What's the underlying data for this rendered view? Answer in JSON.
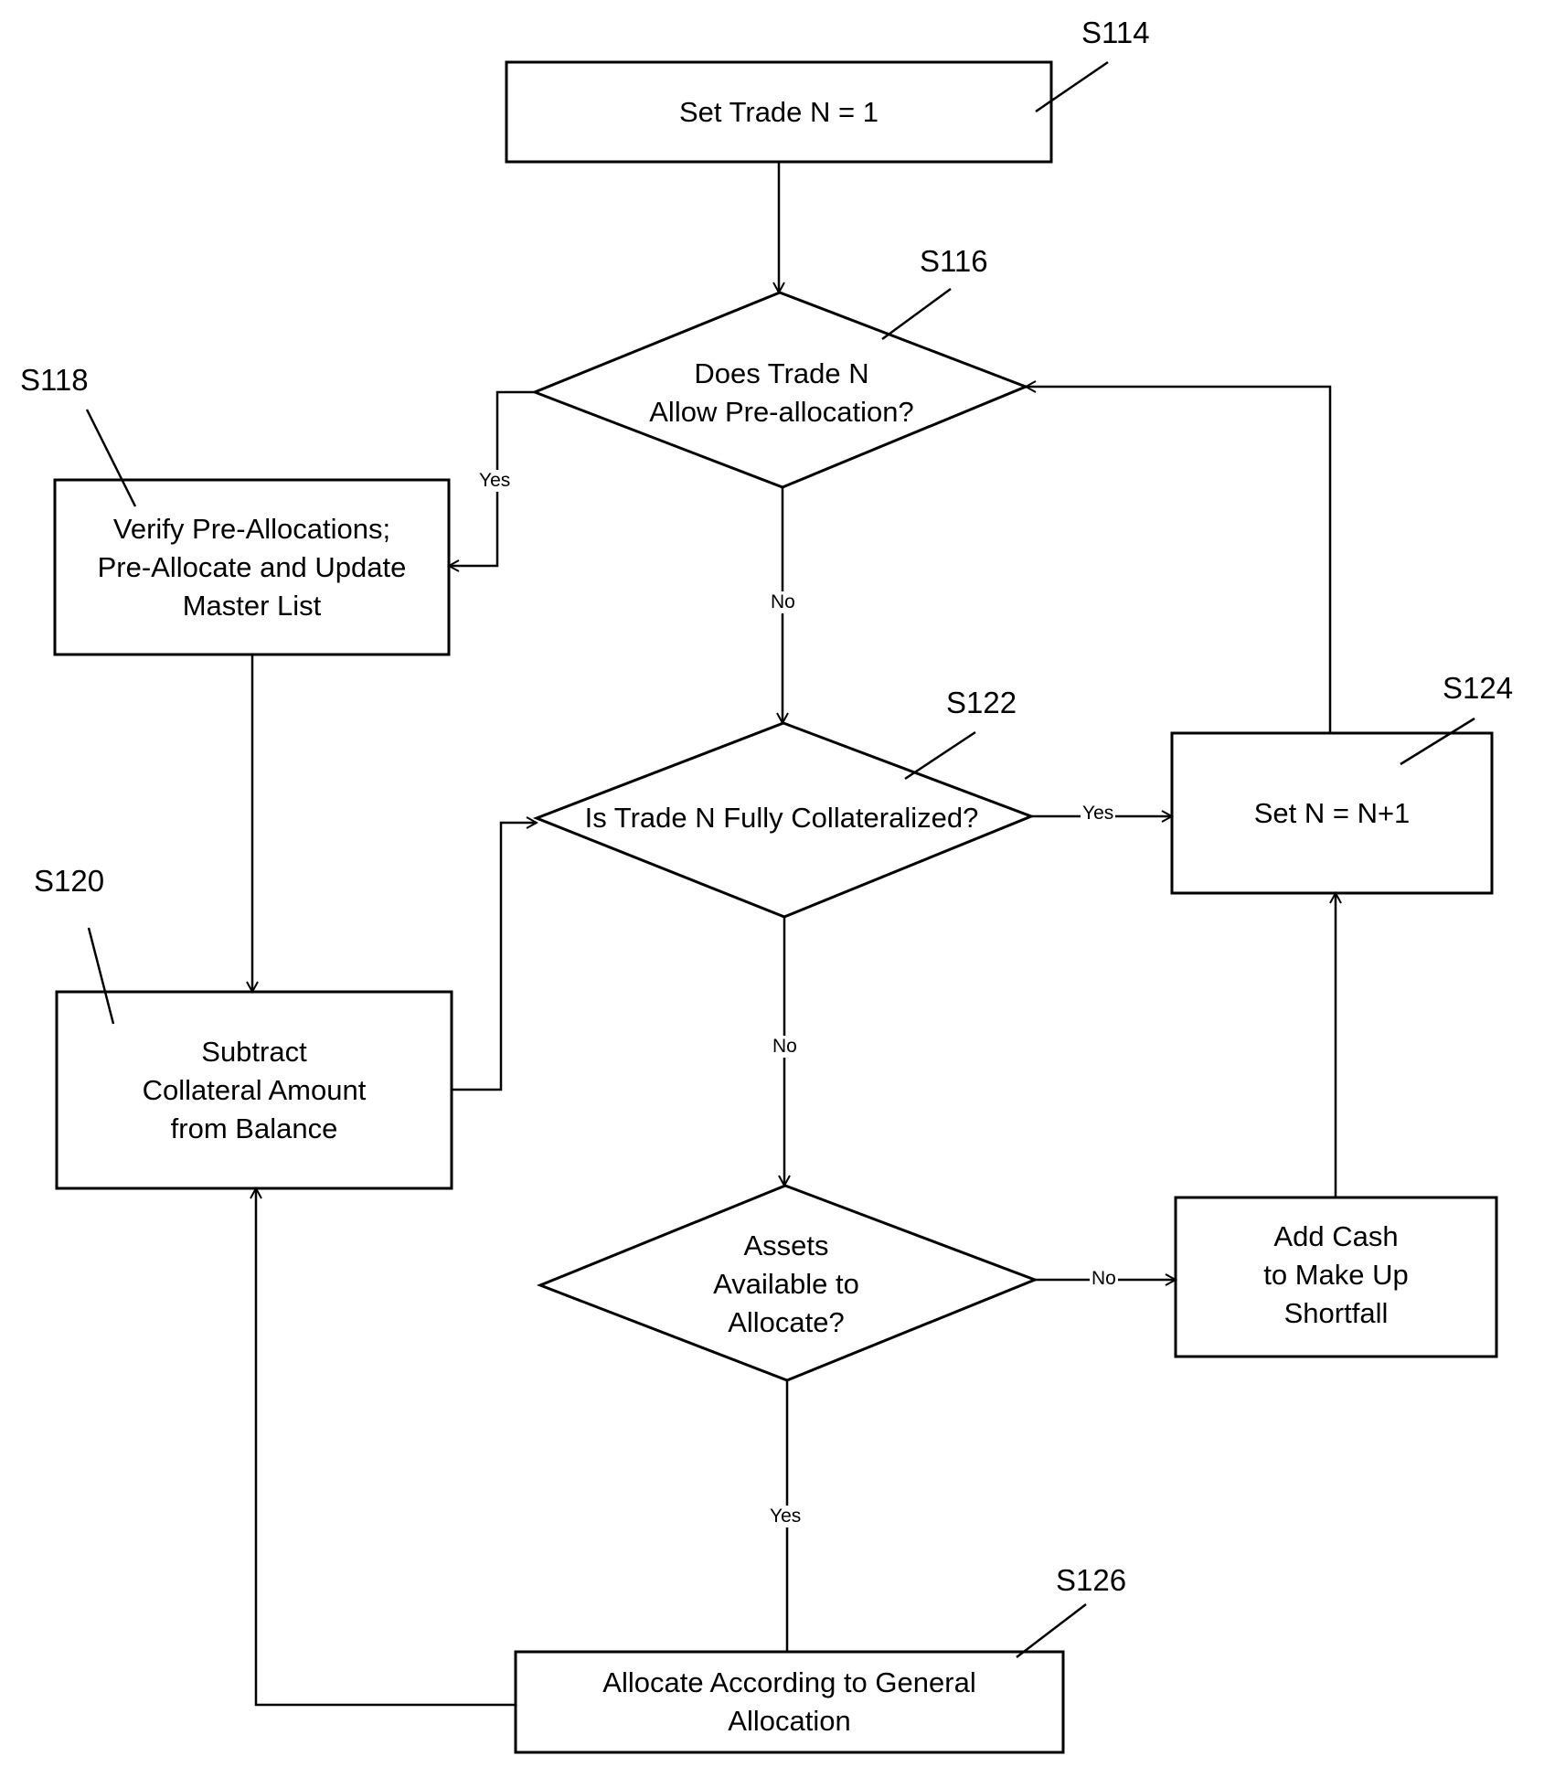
{
  "nodes": {
    "s114": {
      "ref": "S114",
      "type": "process",
      "text": "Set Trade N = 1"
    },
    "s116": {
      "ref": "S116",
      "type": "decision",
      "text_lines": [
        "Does Trade N",
        "Allow Pre-allocation?"
      ]
    },
    "s118": {
      "ref": "S118",
      "type": "process",
      "text_lines": [
        "Verify Pre-Allocations;",
        "Pre-Allocate and Update",
        "Master List"
      ]
    },
    "s120": {
      "ref": "S120",
      "type": "process",
      "text_lines": [
        "Subtract",
        "Collateral Amount",
        "from Balance"
      ]
    },
    "s122": {
      "ref": "S122",
      "type": "decision",
      "text": "Is Trade N Fully Collateralized?"
    },
    "s124": {
      "ref": "S124",
      "type": "process",
      "text": "Set N = N+1"
    },
    "assets": {
      "type": "decision",
      "text_lines": [
        "Assets",
        "Available to",
        "Allocate?"
      ]
    },
    "addcash": {
      "type": "process",
      "text_lines": [
        "Add Cash",
        "to Make Up",
        "Shortfall"
      ]
    },
    "s126": {
      "ref": "S126",
      "type": "process",
      "text_lines": [
        "Allocate According to General",
        "Allocation"
      ]
    }
  },
  "edges": [
    {
      "from": "S114",
      "to": "S116",
      "label": ""
    },
    {
      "from": "S116",
      "to": "S118",
      "label": "Yes"
    },
    {
      "from": "S116",
      "to": "S122",
      "label": "No"
    },
    {
      "from": "S118",
      "to": "S120",
      "label": ""
    },
    {
      "from": "S120",
      "to": "S122",
      "label": ""
    },
    {
      "from": "S122",
      "to": "S124",
      "label": "Yes"
    },
    {
      "from": "S122",
      "to": "Assets Available to Allocate?",
      "label": "No"
    },
    {
      "from": "Assets Available to Allocate?",
      "to": "Add Cash to Make Up Shortfall",
      "label": "No"
    },
    {
      "from": "Assets Available to Allocate?",
      "to": "S126",
      "label": "Yes"
    },
    {
      "from": "Add Cash to Make Up Shortfall",
      "to": "S124",
      "label": ""
    },
    {
      "from": "S124",
      "to": "S116",
      "label": ""
    },
    {
      "from": "S126",
      "to": "S120",
      "label": ""
    }
  ],
  "edge_labels": {
    "s116_yes": "Yes",
    "s116_no": "No",
    "s122_yes": "Yes",
    "s122_no": "No",
    "assets_no": "No",
    "assets_yes": "Yes"
  }
}
